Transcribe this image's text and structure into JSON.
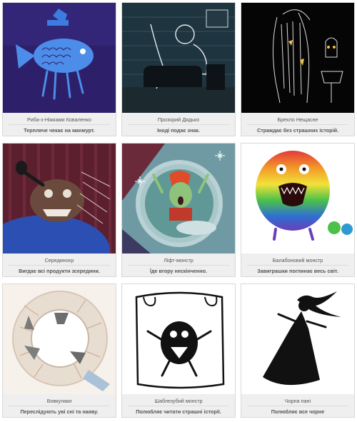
{
  "cards": [
    {
      "name": "Риба-з-Ніжками Коваленко",
      "desc": "Терпляче чекає на манмурт.",
      "art_icon": "fish-with-legs-monster-icon"
    },
    {
      "name": "Прозорий Дядько",
      "desc": "Іноді подає знак.",
      "art_icon": "transparent-man-monster-icon"
    },
    {
      "name": "Брехло Нещасне",
      "desc": "Страждає без страшних історій.",
      "art_icon": "hairy-liar-monster-icon"
    },
    {
      "name": "Серединоєр",
      "desc": "Вигдає всі продукти зсередини.",
      "art_icon": "middle-eater-monster-icon"
    },
    {
      "name": "Ліфт-монстр",
      "desc": "Їде вгору нескінченно.",
      "art_icon": "elevator-monster-icon"
    },
    {
      "name": "Балабоновий монстр",
      "desc": "Завиграшки поглинає весь світ.",
      "art_icon": "rainbow-fluffy-monster-icon"
    },
    {
      "name": "Вовкулаки",
      "desc": "Переслідують уві сні та наяву.",
      "art_icon": "werewolves-monster-icon"
    },
    {
      "name": "Шаблезубий монстр",
      "desc": "Полюбляє читати страшні історії.",
      "art_icon": "sabertooth-monster-icon"
    },
    {
      "name": "Чорна пані",
      "desc": "Полюбляє все чорне",
      "art_icon": "black-lady-monster-icon"
    }
  ]
}
